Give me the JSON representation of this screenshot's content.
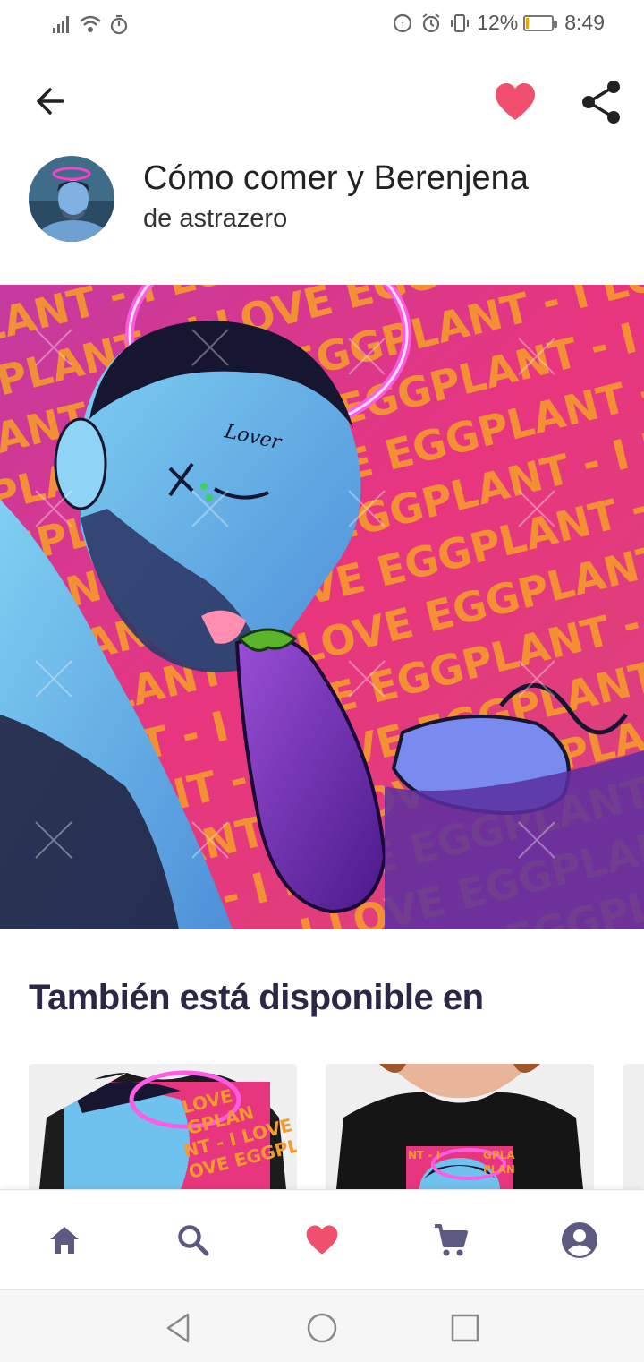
{
  "status_bar": {
    "battery_percent": "12%",
    "battery_level": 0.12,
    "time": "8:49",
    "icons_left": [
      "signal-icon",
      "wifi-icon",
      "timer-icon"
    ],
    "icons_right": [
      "data-saver-icon",
      "alarm-icon",
      "vibrate-icon",
      "battery-icon"
    ]
  },
  "appbar": {
    "icons": [
      "back-arrow-icon",
      "heart-icon",
      "share-icon"
    ],
    "favorite_color": "#f0506e"
  },
  "artwork_header": {
    "title": "Cómo comer y Berenjena",
    "artist": "de astrazero"
  },
  "artwork": {
    "watermark_text": "I LOVE EGGPLANT - I LOVE EGGPLANT - I LOVE EGGPLANT -",
    "face_text": "Lover",
    "background_color": "#e8367e",
    "text_color": "#f59a2c"
  },
  "also_available": {
    "title": "También está disponible en"
  },
  "bottom_nav": {
    "items": [
      "home-icon",
      "search-icon",
      "heart-icon",
      "cart-icon",
      "account-icon"
    ],
    "active": "heart-icon",
    "icon_color": "#5d5a82",
    "active_color": "#f0506e"
  },
  "system_nav": {
    "buttons": [
      "back-triangle-icon",
      "home-circle-icon",
      "recents-square-icon"
    ]
  }
}
